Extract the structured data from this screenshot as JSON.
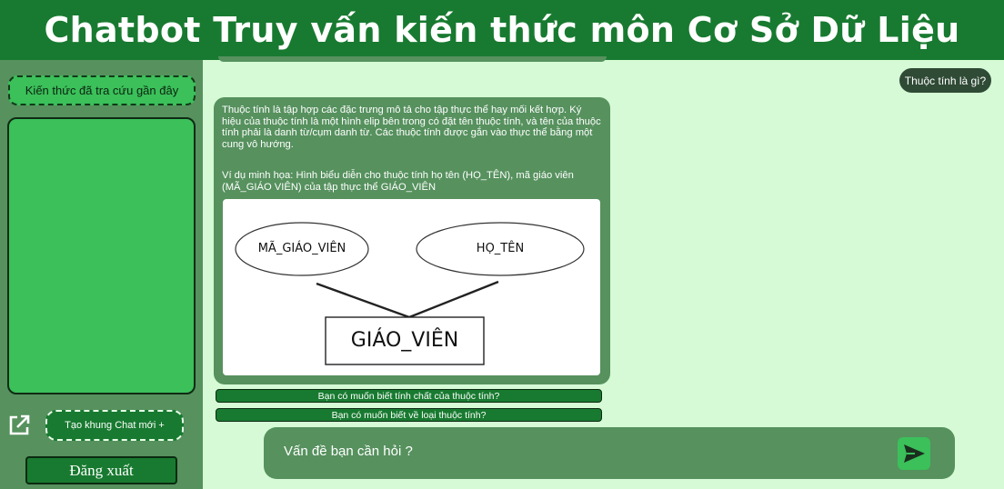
{
  "header": {
    "title": "Chatbot Truy vấn kiến thức môn Cơ Sở Dữ Liệu"
  },
  "sidebar": {
    "recent_label": "Kiến thức đã tra cứu gần đây",
    "new_chat_icon": "edit-external-icon",
    "new_chat_label": "Tạo khung Chat mới +",
    "logout_label": "Đăng xuất"
  },
  "chat": {
    "user_message": "Thuộc tính là gì?",
    "bot_text": "Thuộc tính là tập hợp các đặc trưng mô tả cho tập thực thể hay mối kết hợp. Ký hiệu của thuộc tính là một hình elip bên trong có đặt tên thuộc tính, và tên của thuộc tính phải là danh từ/cụm danh từ. Các thuộc tính được gắn vào thực thể bằng một cung vô hướng.",
    "bot_example": "Ví dụ minh họa: Hình biểu diễn cho thuộc tính họ tên (HỌ_TÊN), mã giáo viên (MÃ_GIÁO VIÊN) của tập thực thể GIÁO_VIÊN",
    "diagram": {
      "attr1": "MÃ_GIÁO_VIÊN",
      "attr2": "HỌ_TÊN",
      "entity": "GIÁO_VIÊN"
    },
    "suggestions": [
      "Bạn có muốn biết tính chất của thuộc tính?",
      "Bạn có muốn biết về loại thuộc tính?"
    ]
  },
  "composer": {
    "placeholder": "Vấn đề bạn cần hỏi ?",
    "send_icon": "send-icon"
  },
  "colors": {
    "header": "#187a30",
    "sidebar": "#56915e",
    "background": "#d5fad5",
    "accent": "#3bc05a"
  }
}
